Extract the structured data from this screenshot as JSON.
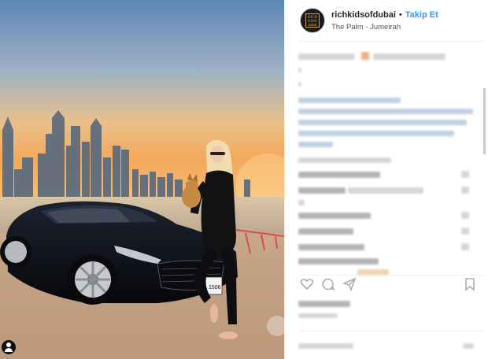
{
  "post": {
    "username": "richkidsofdubai",
    "separator": "•",
    "follow_label": "Takip Et",
    "location": "The Palm - Jumeirah",
    "avatar_text": "RICH KIDS dubai"
  },
  "car": {
    "plate_text": "L 1506"
  },
  "colors": {
    "follow_blue": "#3897f0",
    "sky_top": "#5d86b6",
    "sky_horizon": "#f3a85a",
    "sand": "#c9a98d"
  },
  "icons": {
    "like": "heart-icon",
    "comment": "comment-icon",
    "share": "share-icon",
    "save": "bookmark-icon",
    "profile": "user-icon"
  }
}
